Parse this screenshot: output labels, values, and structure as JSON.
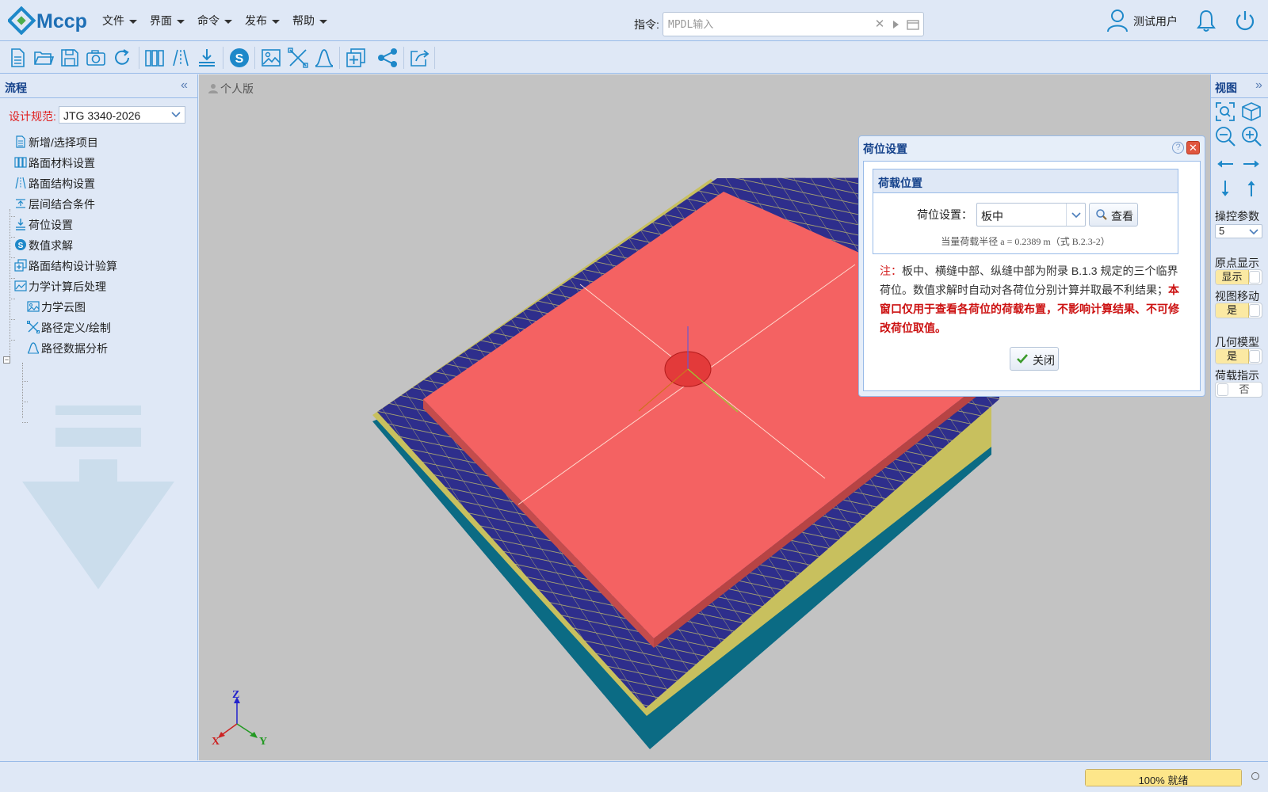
{
  "app": {
    "logo_text": "Mccp"
  },
  "menu": [
    {
      "label": "文件"
    },
    {
      "label": "界面"
    },
    {
      "label": "命令"
    },
    {
      "label": "发布"
    },
    {
      "label": "帮助"
    }
  ],
  "command": {
    "label": "指令:",
    "placeholder": "MPDL输入"
  },
  "user": {
    "name": "测试用户"
  },
  "colors": {
    "accent": "#1e88c9",
    "panel_bg": "#dfe8f6",
    "border": "#99bbe8",
    "title_blue": "#15428b",
    "slab_red": "#f46262",
    "mesh_blue": "#2e2e8c",
    "base_teal": "#0b6b84",
    "edge_yellow": "#d8d466"
  },
  "toolbar_icons": [
    "new-file-icon",
    "open-folder-icon",
    "save-icon",
    "camera-icon",
    "refresh-icon",
    "material-icon",
    "structure-icon",
    "load-icon",
    "solve-icon",
    "image-icon",
    "path-icon",
    "curve-icon",
    "check-icon",
    "share-icon",
    "export-icon"
  ],
  "left_panel": {
    "title": "流程",
    "spec_label": "设计规范:",
    "spec_value": "JTG 3340-2026",
    "tree": [
      {
        "label": "新增/选择项目",
        "icon": "document-icon"
      },
      {
        "label": "路面材料设置",
        "icon": "material-icon"
      },
      {
        "label": "路面结构设置",
        "icon": "structure-icon"
      },
      {
        "label": "层间结合条件",
        "icon": "layer-bond-icon"
      },
      {
        "label": "荷位设置",
        "icon": "load-position-icon"
      },
      {
        "label": "数值求解",
        "icon": "solve-icon"
      },
      {
        "label": "路面结构设计验算",
        "icon": "check-icon"
      },
      {
        "label": "力学计算后处理",
        "icon": "postprocess-icon",
        "children": [
          {
            "label": "力学云图",
            "icon": "image-icon"
          },
          {
            "label": "路径定义/绘制",
            "icon": "path-icon"
          },
          {
            "label": "路径数据分析",
            "icon": "curve-icon"
          }
        ]
      }
    ]
  },
  "viewport": {
    "edition": "个人版",
    "axes": {
      "x": "X",
      "y": "Y",
      "z": "Z"
    }
  },
  "dialog": {
    "title": "荷位设置",
    "section_title": "荷载位置",
    "position_label": "荷位设置：",
    "position_value": "板中",
    "view_button": "查看",
    "radius_note": "当量荷载半径 a = 0.2389 m（式 B.2.3-2）",
    "note_prefix": "注：",
    "note_text": "板中、横缝中部、纵缝中部为附录 B.1.3 规定的三个临界荷位。数值求解时自动对各荷位分别计算并取最不利结果；",
    "note_emphasis": "本窗口仅用于查看各荷位的荷载布置，不影响计算结果、不可修改荷位取值。",
    "close_button": "关闭"
  },
  "right_panel": {
    "title": "视图",
    "param_label": "操控参数",
    "param_value": "5",
    "origin_label": "原点显示",
    "origin_value": "显示",
    "move_label": "视图移动",
    "move_value": "是",
    "geom_label": "几何模型",
    "geom_value": "是",
    "load_label": "荷载指示",
    "load_value": "否"
  },
  "status": {
    "progress_text": "100% 就绪",
    "progress": 1.0
  }
}
